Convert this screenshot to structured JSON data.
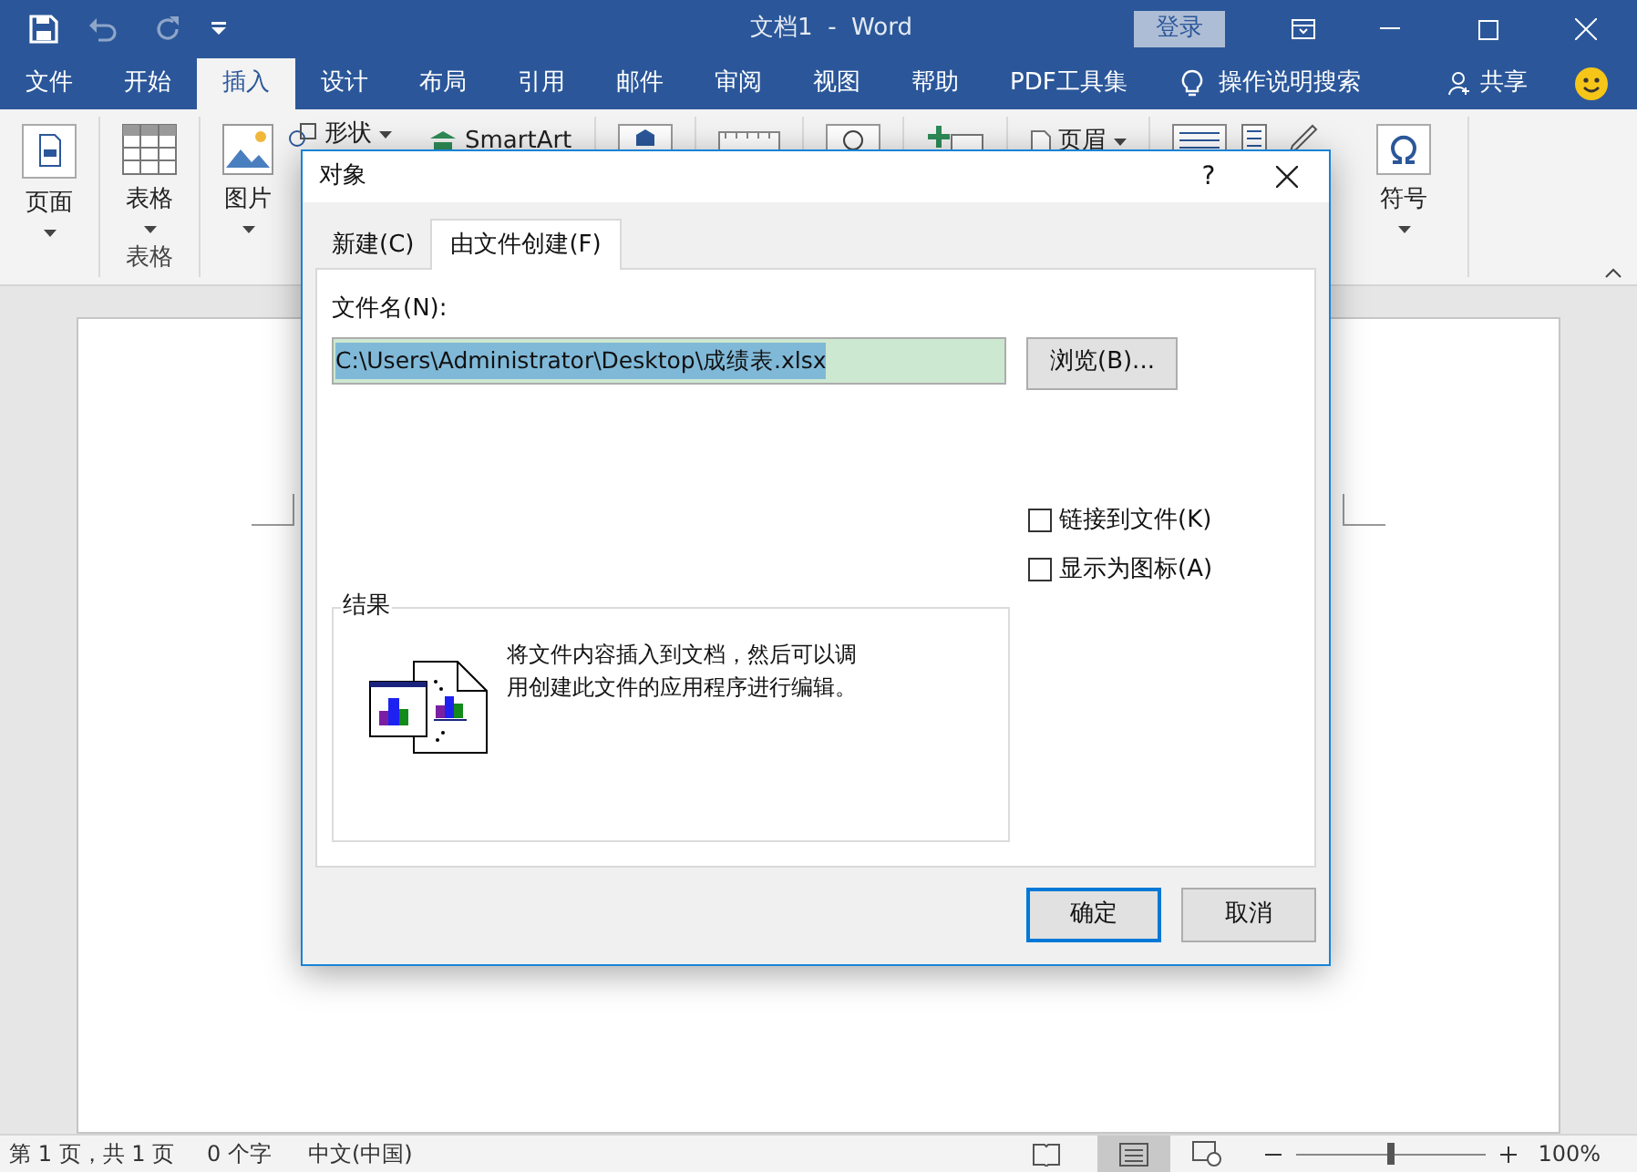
{
  "window": {
    "title": "文档1  -  Word",
    "signin": "登录"
  },
  "ribbon_tabs": [
    {
      "label": "文件",
      "selected": false
    },
    {
      "label": "开始",
      "selected": false
    },
    {
      "label": "插入",
      "selected": true
    },
    {
      "label": "设计",
      "selected": false
    },
    {
      "label": "布局",
      "selected": false
    },
    {
      "label": "引用",
      "selected": false
    },
    {
      "label": "邮件",
      "selected": false
    },
    {
      "label": "审阅",
      "selected": false
    },
    {
      "label": "视图",
      "selected": false
    },
    {
      "label": "帮助",
      "selected": false
    },
    {
      "label": "PDF工具集",
      "selected": false
    }
  ],
  "tell_me": "操作说明搜索",
  "share": "共享",
  "ribbon": {
    "page": "页面",
    "table": "表格",
    "table_group": "表格",
    "picture": "图片",
    "shapes": "形状",
    "smartart": "SmartArt",
    "header": "页眉",
    "symbol": "符号"
  },
  "dialog": {
    "title": "对象",
    "help": "?",
    "tabs": [
      {
        "label": "新建(C)",
        "selected": false
      },
      {
        "label": "由文件创建(F)",
        "selected": true
      }
    ],
    "file_label": "文件名(N):",
    "file_value": "C:\\Users\\Administrator\\Desktop\\成绩表.xlsx",
    "browse": "浏览(B)...",
    "options": [
      {
        "label": "链接到文件(K)",
        "checked": false
      },
      {
        "label": "显示为图标(A)",
        "checked": false
      }
    ],
    "result_title": "结果",
    "result_text": "将文件内容插入到文档，然后可以调用创建此文件的应用程序进行编辑。",
    "ok": "确定",
    "cancel": "取消"
  },
  "status_bar": {
    "page": "第 1 页，共 1 页",
    "words": "0 个字",
    "language": "中文(中国)",
    "zoom_slider": {
      "level": 0.5
    },
    "zoom": "100%"
  }
}
